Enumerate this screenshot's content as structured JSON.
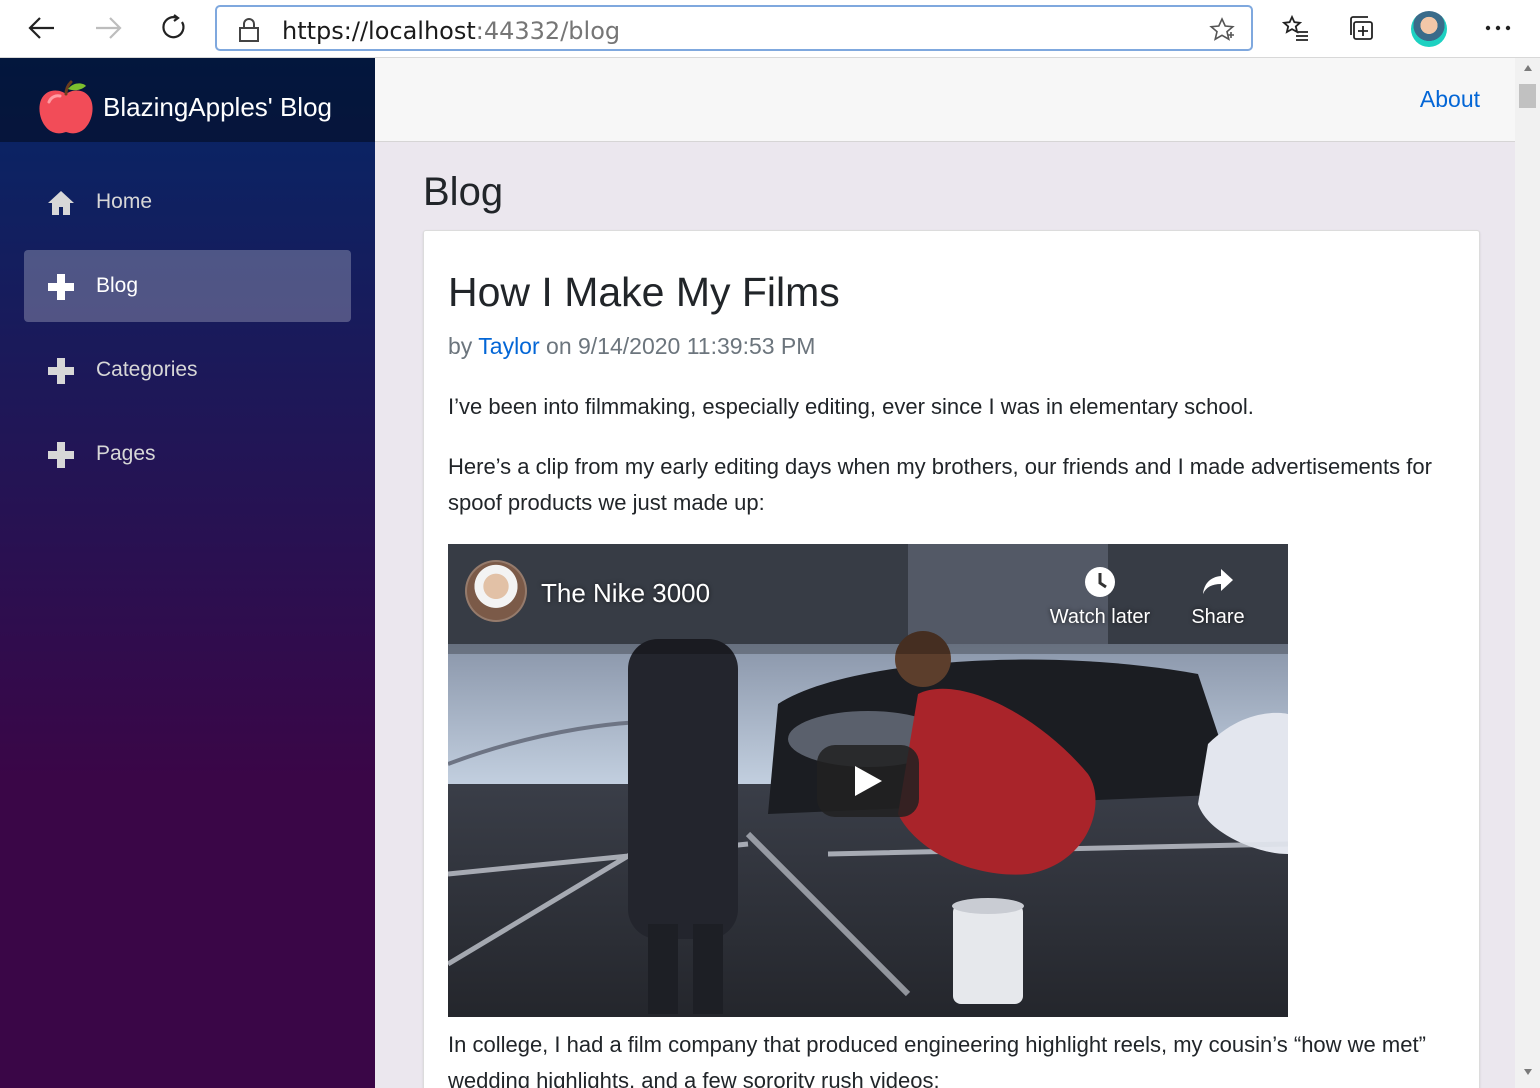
{
  "browser": {
    "url_prefix": "https://localhost",
    "url_port": ":44332",
    "url_path": "/blog",
    "icons": [
      "back-icon",
      "forward-icon",
      "refresh-icon",
      "lock-icon",
      "favorite-star-icon",
      "favorites-list-icon",
      "collections-icon",
      "profile-avatar",
      "more-icon"
    ]
  },
  "sidebar": {
    "brand": "BlazingApples' Blog",
    "items": [
      {
        "label": "Home",
        "icon": "home-icon",
        "active": false
      },
      {
        "label": "Blog",
        "icon": "plus-icon",
        "active": true
      },
      {
        "label": "Categories",
        "icon": "plus-icon",
        "active": false
      },
      {
        "label": "Pages",
        "icon": "plus-icon",
        "active": false
      }
    ]
  },
  "topbar": {
    "about": "About"
  },
  "page": {
    "title": "Blog"
  },
  "post": {
    "title": "How I Make My Films",
    "by": "by",
    "author": "Taylor",
    "on": "on 9/14/2020 11:39:53 PM",
    "p1": "I’ve been into filmmaking, especially editing, ever since I was in elementary school.",
    "p2": "Here’s a clip from my early editing days when my brothers, our friends and I made advertisements for spoof products we just made up:",
    "p3": "In college, I had a film company that produced engineering highlight reels, my cousin’s “how we met” wedding highlights, and a few sorority rush videos:"
  },
  "video": {
    "title": "The Nike 3000",
    "watch_later": "Watch later",
    "share": "Share"
  },
  "colors": {
    "sidebar_top": "#052767",
    "sidebar_bottom": "#3a0647",
    "link": "#0366d6",
    "main_bg": "#ebe7ee"
  }
}
